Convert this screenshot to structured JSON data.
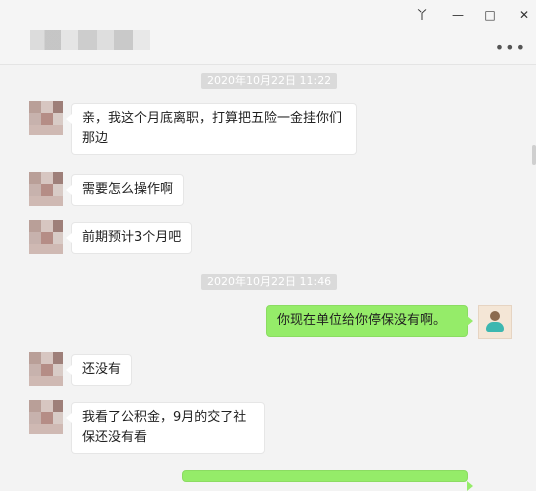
{
  "window_controls": {
    "pin": "丫",
    "minimize": "—",
    "maximize": "□",
    "close": "✕"
  },
  "header": {
    "more": "•••"
  },
  "timestamps": [
    "2020年10月22日 11:22",
    "2020年10月22日 11:46"
  ],
  "messages": [
    "亲，我这个月底离职，打算把五险一金挂你们那边",
    "需要怎么操作啊",
    "前期预计3个月吧",
    "你现在单位给你停保没有啊。",
    "还没有",
    "我看了公积金，9月的交了社保还没有看"
  ],
  "colors": {
    "my_bubble": "#95ec69",
    "other_bubble": "#ffffff",
    "background": "#f3f3f3"
  }
}
